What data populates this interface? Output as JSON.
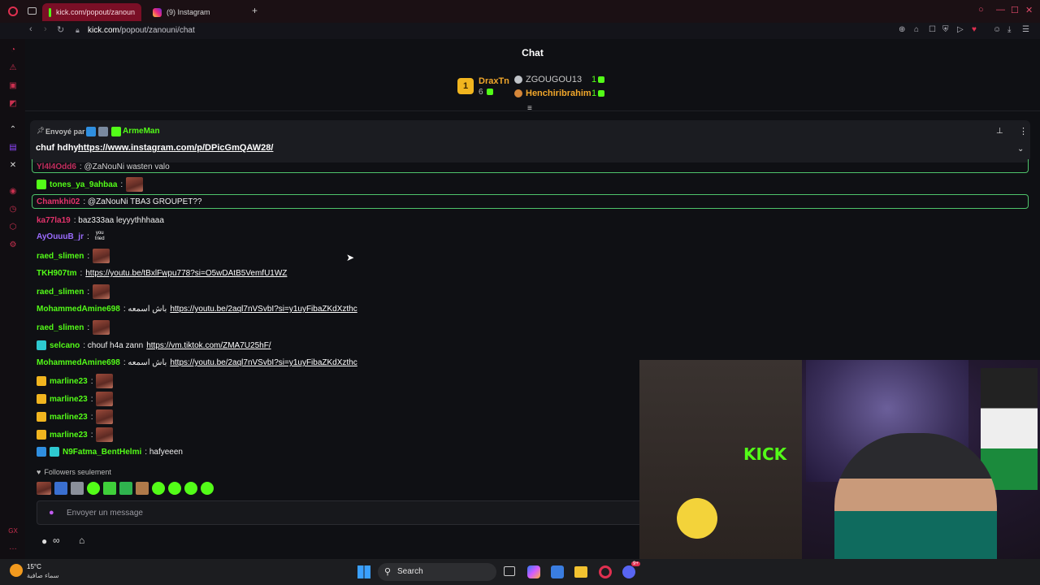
{
  "browser": {
    "tabs": [
      {
        "label": "kick.com/popout/zanoun",
        "active": true
      },
      {
        "label": "(9) Instagram",
        "active": false
      }
    ],
    "new_tab": "+",
    "url_host": "kick.com",
    "url_path": "/popout/zanouni/chat"
  },
  "chat": {
    "title": "Chat",
    "leaderboard": {
      "top": {
        "rank": "1",
        "name": "DraxTn",
        "count": "6"
      },
      "second": {
        "name": "ZGOUGOU13",
        "count": "1"
      },
      "third": {
        "name": "Henchiribrahim",
        "count": "1"
      }
    },
    "pinned": {
      "sent_by": "Envoyé par",
      "author": "ArmeMan",
      "text": "chuf hdhy",
      "link": "https://www.instagram.com/p/DPicGmQAW28/"
    },
    "messages": [
      {
        "user": "Yl4l4Odd6",
        "text": ": @ZaNouNi wasten valo"
      },
      {
        "user": "tones_ya_9ahbaa",
        "text": ":"
      },
      {
        "user": "Chamkhi02",
        "text": ": @ZaNouNi TBA3 GROUPET??"
      },
      {
        "user": "ka77la19",
        "text": ": baz333aa leyyythhhaaa"
      },
      {
        "user": "AyOuuuB_jr",
        "text": ":",
        "emote_label": "you tried"
      },
      {
        "user": "raed_slimen",
        "text": ":"
      },
      {
        "user": "TKH907tm",
        "text": ":",
        "link": "https://youtu.be/tBxlFwpu778?si=O5wDAtB5VemfU1WZ"
      },
      {
        "user": "raed_slimen",
        "text": ":"
      },
      {
        "user": "MohammedAmine698",
        "text": ": باش اسمعه",
        "link": "https://youtu.be/2aql7nVSvbI?si=y1uyFibaZKdXzthc"
      },
      {
        "user": "raed_slimen",
        "text": ":"
      },
      {
        "user": "selcano",
        "text": ": chouf h4a zann",
        "link": "https://vm.tiktok.com/ZMA7U25hF/"
      },
      {
        "user": "MohammedAmine698",
        "text": ": باش اسمعه",
        "link": "https://youtu.be/2aql7nVSvbI?si=y1uyFibaZKdXzthc"
      },
      {
        "user": "marline23",
        "text": ":"
      },
      {
        "user": "marline23",
        "text": ":"
      },
      {
        "user": "marline23",
        "text": ":"
      },
      {
        "user": "marline23",
        "text": ":"
      },
      {
        "user": "N9Fatma_BentHelmi",
        "text": ": hafyeeen"
      }
    ],
    "followers_only": "Followers seulement",
    "input_placeholder": "Envoyer un message"
  },
  "video": {
    "neon_sign": "KICK"
  },
  "taskbar": {
    "weather_temp": "15°C",
    "weather_desc": "سماء صافية",
    "search": "Search",
    "discord_badge": "9+"
  },
  "colors": {
    "accent_green": "#53fc18",
    "browser_red": "#7a0f26",
    "link": "#ffffff",
    "medal_gold": "#f1b51f"
  }
}
